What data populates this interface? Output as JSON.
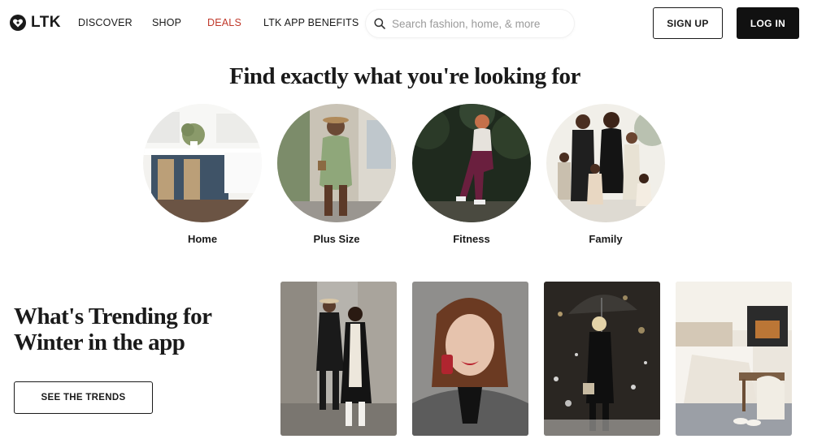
{
  "header": {
    "logo_text": "LTK",
    "nav": {
      "discover": "DISCOVER",
      "shop": "SHOP",
      "deals": "DEALS",
      "app_benefits": "LTK APP BENEFITS"
    },
    "search_placeholder": "Search fashion, home, & more",
    "signup_label": "SIGN UP",
    "login_label": "LOG IN"
  },
  "categories_section": {
    "title": "Find exactly what you're looking for",
    "items": [
      {
        "label": "Home"
      },
      {
        "label": "Plus Size"
      },
      {
        "label": "Fitness"
      },
      {
        "label": "Family"
      }
    ]
  },
  "trending": {
    "title": "What's Trending for Winter in the app",
    "button_label": "SEE THE TRENDS",
    "cards": [
      "Street style couple",
      "Red lipstick makeup",
      "Snowy night outfit",
      "Cozy bedroom"
    ]
  },
  "colors": {
    "deals_red": "#c0392b",
    "login_bg": "#111111"
  }
}
